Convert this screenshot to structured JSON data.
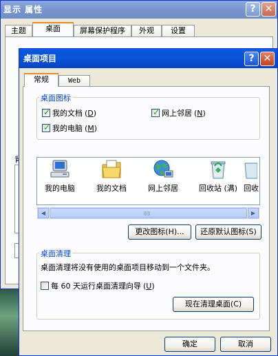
{
  "back_window": {
    "title": "显示 属性",
    "help_glyph": "?",
    "close_glyph": "✕",
    "tabs": [
      "主题",
      "桌面",
      "屏幕保护程序",
      "外观",
      "设置"
    ],
    "active_tab": "桌面",
    "stub_text": "背"
  },
  "dialog": {
    "title": "桌面项目",
    "help_glyph": "?",
    "close_glyph": "✕",
    "tabs": [
      "常规",
      "Web"
    ],
    "active_tab": "常规",
    "icons_group": {
      "legend": "桌面图标",
      "checkboxes": [
        {
          "label": "我的文档",
          "key": "D",
          "checked": true
        },
        {
          "label": "网上邻居",
          "key": "N",
          "checked": true
        },
        {
          "label": "我的电脑",
          "key": "M",
          "checked": true
        }
      ],
      "items": [
        "我的电脑",
        "我的文档",
        "网上邻居",
        "回收站 (满)",
        "回收"
      ]
    },
    "buttons": {
      "change_icon": "更改图标(H)...",
      "restore_default": "还原默认图标(S)"
    },
    "cleanup_group": {
      "legend": "桌面清理",
      "description": "桌面清理将没有使用的桌面项目移动到一个文件夹。",
      "wizard_checkbox": {
        "prefix": "每 60 天运行桌面清理向导",
        "key": "U",
        "checked": false
      },
      "clean_now": "现在清理桌面(C)"
    },
    "ok": "确定",
    "cancel": "取消"
  },
  "colors": {
    "active_title": "#0a54d6",
    "inactive_title": "#7796ce",
    "group_legend": "#0046d5",
    "face": "#ece9d8"
  }
}
